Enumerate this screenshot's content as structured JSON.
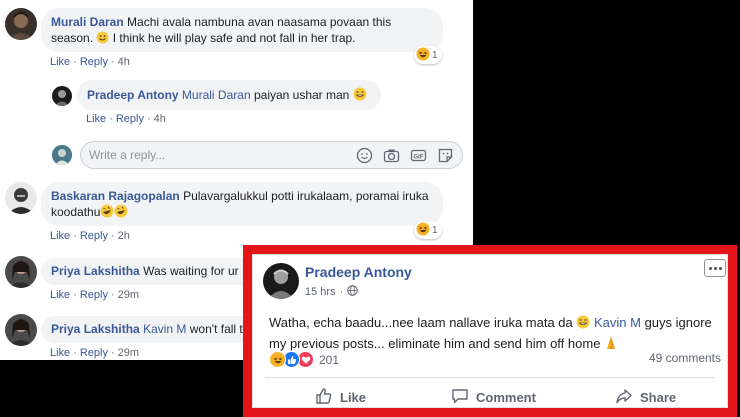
{
  "thread": {
    "comments": [
      {
        "author": "Murali Daran",
        "text_line1": "Machi avala nambuna avan naasama povaan this",
        "text_line2_pre": "season. ",
        "text_line2_post": " I think he will play safe and not fall in her trap.",
        "like": "Like",
        "reply": "Reply",
        "time": "4h",
        "reaction_count": "1",
        "reaction": "haha"
      },
      {
        "author": "Pradeep Antony",
        "mention": "Murali Daran",
        "text": "paiyan ushar man",
        "like": "Like",
        "reply": "Reply",
        "time": "4h"
      },
      {
        "author": "Baskaran Rajagopalan",
        "text_line1": "Pulavargalukkul potti irukalaam, poramai iruka",
        "text_line2": "koodathu",
        "like": "Like",
        "reply": "Reply",
        "time": "2h",
        "reaction_count": "1",
        "reaction": "haha"
      },
      {
        "author": "Priya Lakshitha",
        "text": "Was waiting for ur",
        "like": "Like",
        "reply": "Reply",
        "time": "29m"
      },
      {
        "author": "Priya Lakshitha",
        "mention": "Kavin M",
        "text": "won't fall t",
        "like": "Like",
        "reply": "Reply",
        "time": "29m"
      }
    ],
    "reply_box": {
      "placeholder": "Write a reply...",
      "icons": [
        "emoji-icon",
        "camera-icon",
        "gif-icon",
        "sticker-icon"
      ]
    }
  },
  "post": {
    "author": "Pradeep Antony",
    "time": "15 hrs",
    "dot": "·",
    "privacy_icon": "globe-icon",
    "text_line1_pre": "Watha, echa baadu...nee laam nallave iruka mata da ",
    "mention": "Kavin M",
    "text_line1_post": " guys ignore",
    "text_line2": "my previous posts... eliminate him and send him off home ",
    "reactions": [
      "haha",
      "like",
      "love"
    ],
    "reaction_count": "201",
    "comments_count": "49 comments",
    "like_label": "Like",
    "comment_label": "Comment",
    "share_label": "Share"
  },
  "colors": {
    "highlight_border": "#e3151a",
    "link_blue": "#385898",
    "bubble_bg": "#f2f3f5",
    "like_blue": "#1877f2",
    "love_red": "#f33e58",
    "haha_yellow": "#f7b125"
  }
}
